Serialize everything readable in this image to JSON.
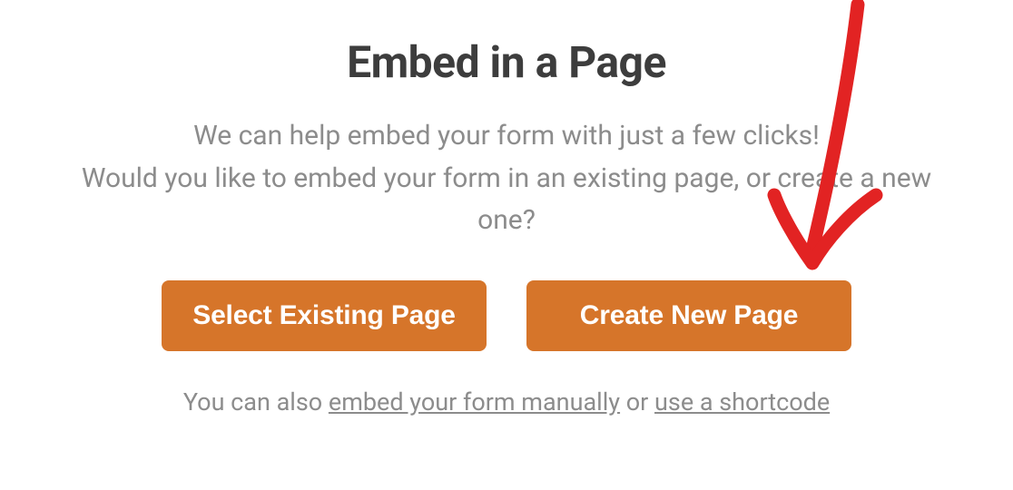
{
  "modal": {
    "title": "Embed in a Page",
    "description_line1": "We can help embed your form with just a few clicks!",
    "description_line2": "Would you like to embed your form in an existing page, or create a new one?",
    "buttons": {
      "select_existing": "Select Existing Page",
      "create_new": "Create New Page"
    },
    "footer": {
      "prefix": "You can also ",
      "link_manual": "embed your form manually",
      "separator": " or ",
      "link_shortcode": "use a shortcode"
    }
  },
  "colors": {
    "button_bg": "#d6752a",
    "title_color": "#3d3d3d",
    "text_muted": "#8c8c8c",
    "annotation": "#e22323"
  }
}
